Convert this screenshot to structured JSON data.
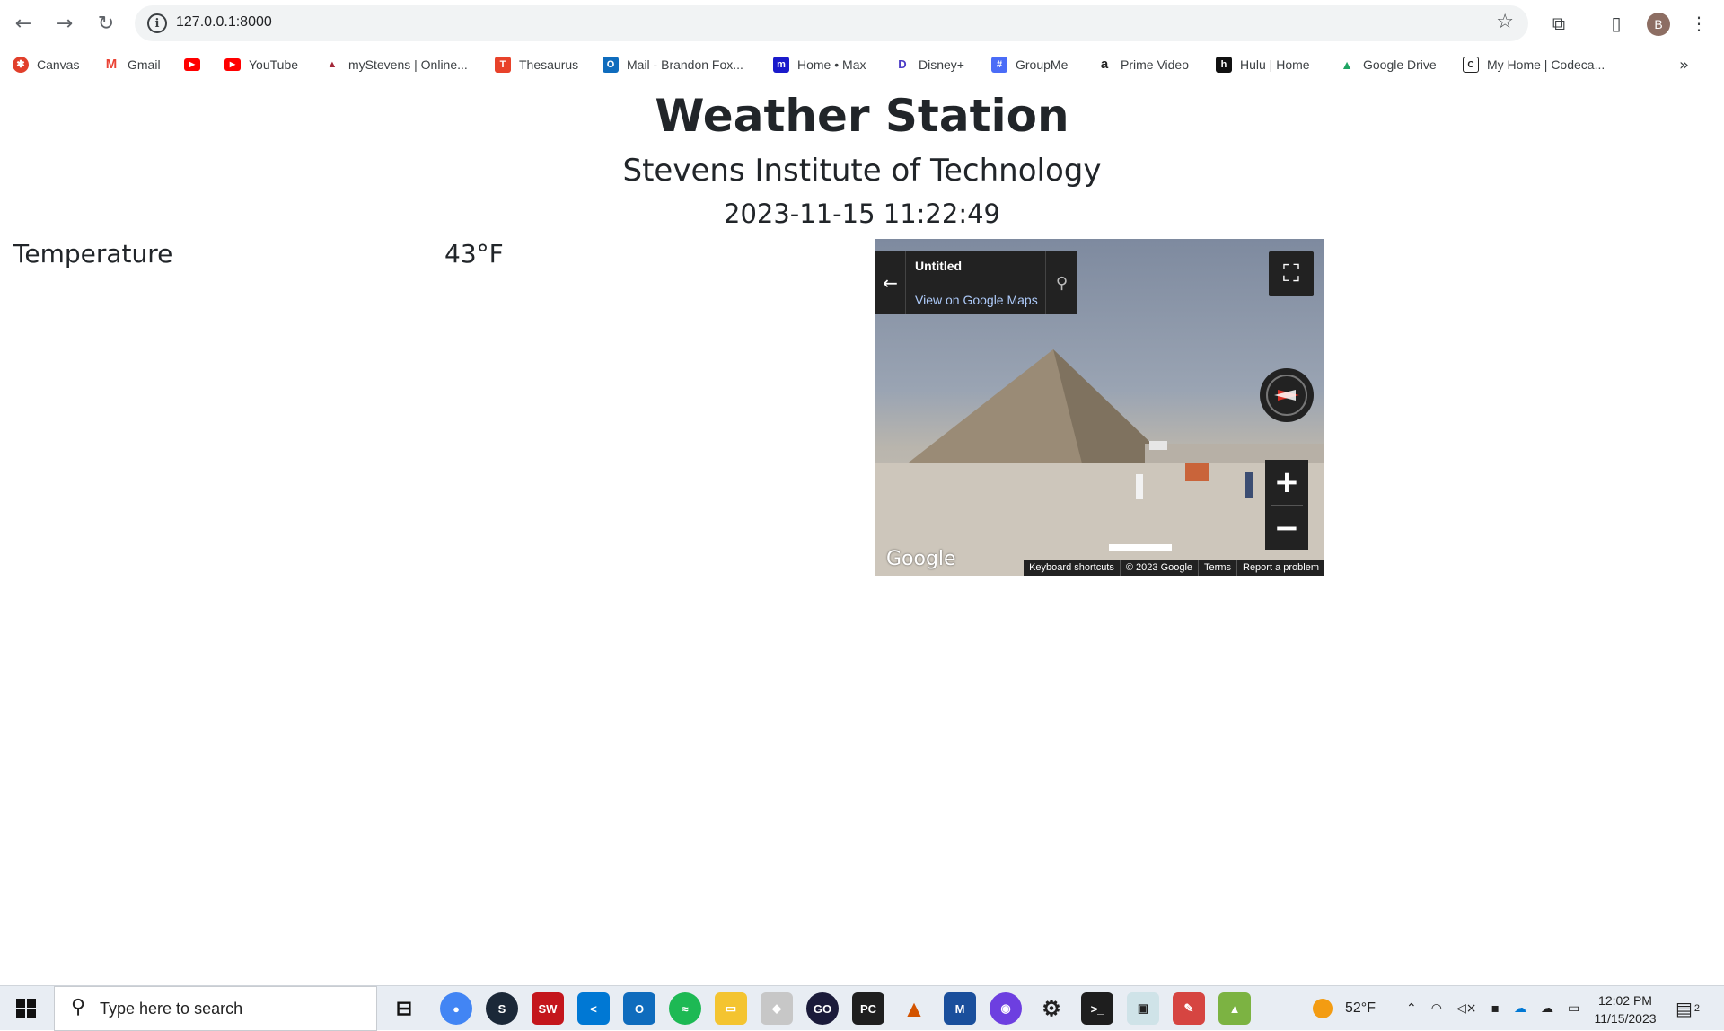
{
  "browser": {
    "url": "127.0.0.1:8000",
    "avatar_initial": "B",
    "bookmarks": [
      {
        "label": "Canvas",
        "icon": "canvas-icon",
        "color": "#e13f2b"
      },
      {
        "label": "Gmail",
        "icon": "gmail-icon",
        "color": "#ea4335"
      },
      {
        "label": "",
        "icon": "youtube-icon",
        "color": "#ff0000"
      },
      {
        "label": "YouTube",
        "icon": "youtube-icon",
        "color": "#ff0000"
      },
      {
        "label": "myStevens | Online...",
        "icon": "stevens-icon",
        "color": "#a32638"
      },
      {
        "label": "Thesaurus",
        "icon": "thesaurus-icon",
        "color": "#e8422a"
      },
      {
        "label": "Mail - Brandon Fox...",
        "icon": "outlook-icon",
        "color": "#0f6cbd"
      },
      {
        "label": "Home • Max",
        "icon": "max-icon",
        "color": "#1a1acb"
      },
      {
        "label": "Disney+",
        "icon": "disney-icon",
        "color": "#4b3cc6"
      },
      {
        "label": "GroupMe",
        "icon": "groupme-icon",
        "color": "#00aff0"
      },
      {
        "label": "Prime Video",
        "icon": "amazon-icon",
        "color": "#222222"
      },
      {
        "label": "Hulu | Home",
        "icon": "hulu-icon",
        "color": "#111111"
      },
      {
        "label": "Google Drive",
        "icon": "drive-icon",
        "color": "#1fa463"
      },
      {
        "label": "My Home | Codeca...",
        "icon": "codecademy-icon",
        "color": "#222222"
      }
    ]
  },
  "page": {
    "title": "Weather Station",
    "subtitle": "Stevens Institute of Technology",
    "timestamp": "2023-11-15 11:22:49",
    "temperature_label": "Temperature",
    "temperature_value": "43°F"
  },
  "streetview": {
    "place_title": "Untitled",
    "link_label": "View on Google Maps",
    "brand": "Google",
    "footer": [
      "Keyboard shortcuts",
      "© 2023 Google",
      "Terms",
      "Report a problem"
    ]
  },
  "taskbar": {
    "search_placeholder": "Type here to search",
    "weather": "52°F",
    "time": "12:02 PM",
    "date": "11/15/2023",
    "notification_count": "2"
  }
}
